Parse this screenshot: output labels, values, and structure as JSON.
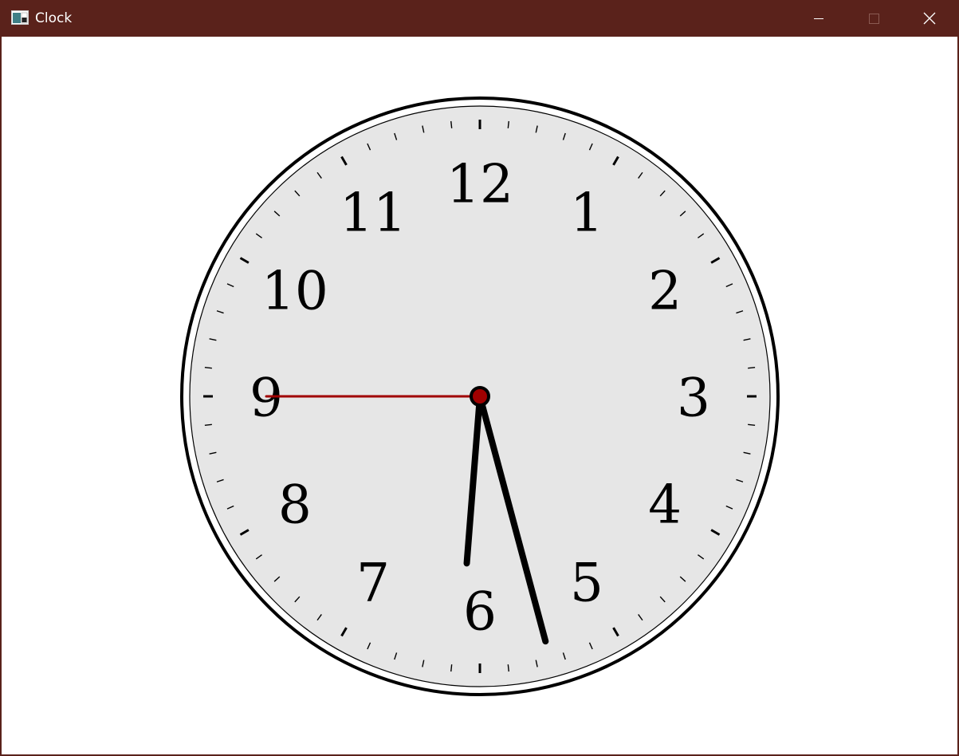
{
  "window": {
    "title": "Clock",
    "icon": "clock-app-icon",
    "titlebar_color": "#5a221b",
    "controls": [
      "minimize-icon",
      "maximize-icon",
      "close-icon"
    ]
  },
  "clock": {
    "numerals": [
      "12",
      "1",
      "2",
      "3",
      "4",
      "5",
      "6",
      "7",
      "8",
      "9",
      "10",
      "11"
    ],
    "time": {
      "hour": 5,
      "minute": 30,
      "second": 45
    },
    "colors": {
      "face": "#e6e6e6",
      "rim": "#000000",
      "hands": "#000000",
      "second_hand": "#a00000"
    }
  }
}
